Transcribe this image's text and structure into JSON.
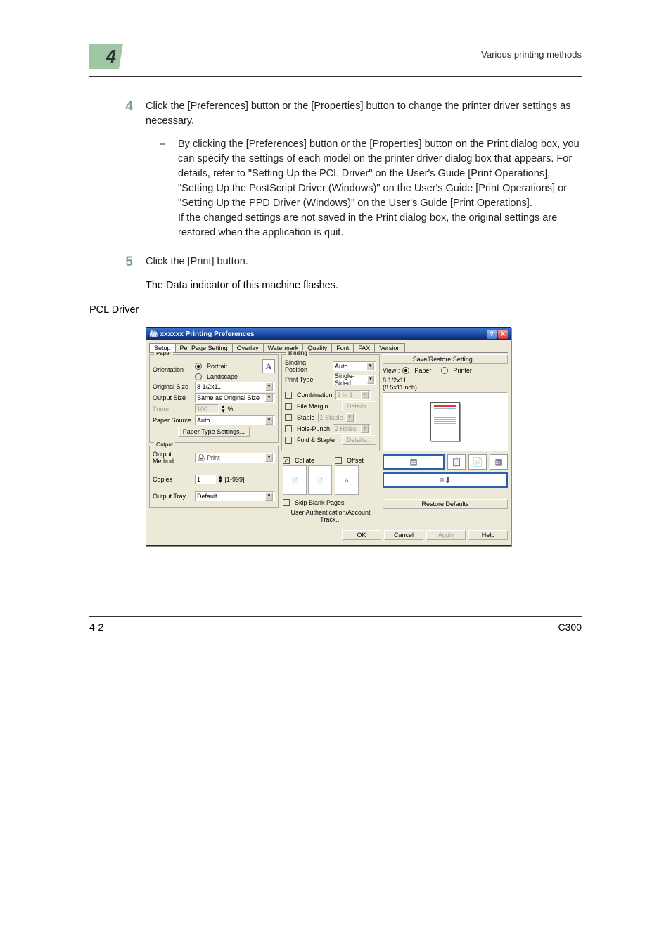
{
  "page": {
    "chapter_number": "4",
    "section_title": "Various printing methods",
    "footer_left": "4-2",
    "footer_right": "C300"
  },
  "step4": {
    "num": "4",
    "text": "Click the [Preferences] button or the [Properties] button to change the printer driver settings as necessary.",
    "sub": "By clicking the [Preferences] button or the [Properties] button on the Print dialog box, you can specify the settings of each model on the printer driver dialog box that appears. For details, refer to \"Setting Up the PCL Driver\" on the User's Guide [Print Operations], \"Setting Up the PostScript Driver (Windows)\" on the User's Guide [Print Operations] or \"Setting Up the PPD Driver (Windows)\" on the User's Guide [Print Operations].\nIf the changed settings are not saved in the Print dialog box, the original settings are restored when the application is quit."
  },
  "step5": {
    "num": "5",
    "text": "Click the [Print] button.",
    "after": "The Data indicator of this machine flashes."
  },
  "caption": "PCL Driver",
  "dlg": {
    "title": "xxxxxx Printing Preferences",
    "help": "?",
    "close": "X",
    "tabs": [
      "Setup",
      "Per Page Setting",
      "Overlay",
      "Watermark",
      "Quality",
      "Font",
      "FAX",
      "Version"
    ],
    "paper": {
      "legend": "Paper",
      "orientation_lbl": "Orientation",
      "portrait": "Portrait",
      "landscape": "Landscape",
      "original_size_lbl": "Original Size",
      "original_size": "8 1/2x11",
      "output_size_lbl": "Output Size",
      "output_size": "Same as Original Size",
      "zoom_lbl": "Zoom",
      "zoom_val": "100",
      "zoom_pct": "%",
      "paper_source_lbl": "Paper Source",
      "paper_source": "Auto",
      "paper_type_btn": "Paper Type Settings..."
    },
    "output": {
      "legend": "Output",
      "method_lbl": "Output Method",
      "method": "Print",
      "copies_lbl": "Copies",
      "copies_val": "1",
      "copies_range": "[1-999]",
      "tray_lbl": "Output Tray",
      "tray": "Default"
    },
    "binding": {
      "legend": "Binding",
      "pos_lbl": "Binding Position",
      "pos": "Auto",
      "ptype_lbl": "Print Type",
      "ptype": "Single-Sided",
      "combination": "Combination",
      "combination_val": "2 in 1",
      "file_margin": "File Margin",
      "details": "Details...",
      "staple": "Staple",
      "staple_val": "1 Staple",
      "hole": "Hole-Punch",
      "hole_val": "2 Holes",
      "fold": "Fold & Staple"
    },
    "mid_bottom": {
      "collate": "Collate",
      "offset": "Offset",
      "skip": "Skip Blank Pages",
      "user_auth": "User Authentication/Account Track..."
    },
    "right": {
      "save_restore": "Save/Restore Setting...",
      "view_lbl": "View :",
      "paper_radio": "Paper",
      "printer_radio": "Printer",
      "size_line1": "8 1/2x11",
      "size_line2": "(8.5x11inch)",
      "restore_defaults": "Restore Defaults"
    },
    "bottom": {
      "ok": "OK",
      "cancel": "Cancel",
      "apply": "Apply",
      "help": "Help"
    }
  }
}
